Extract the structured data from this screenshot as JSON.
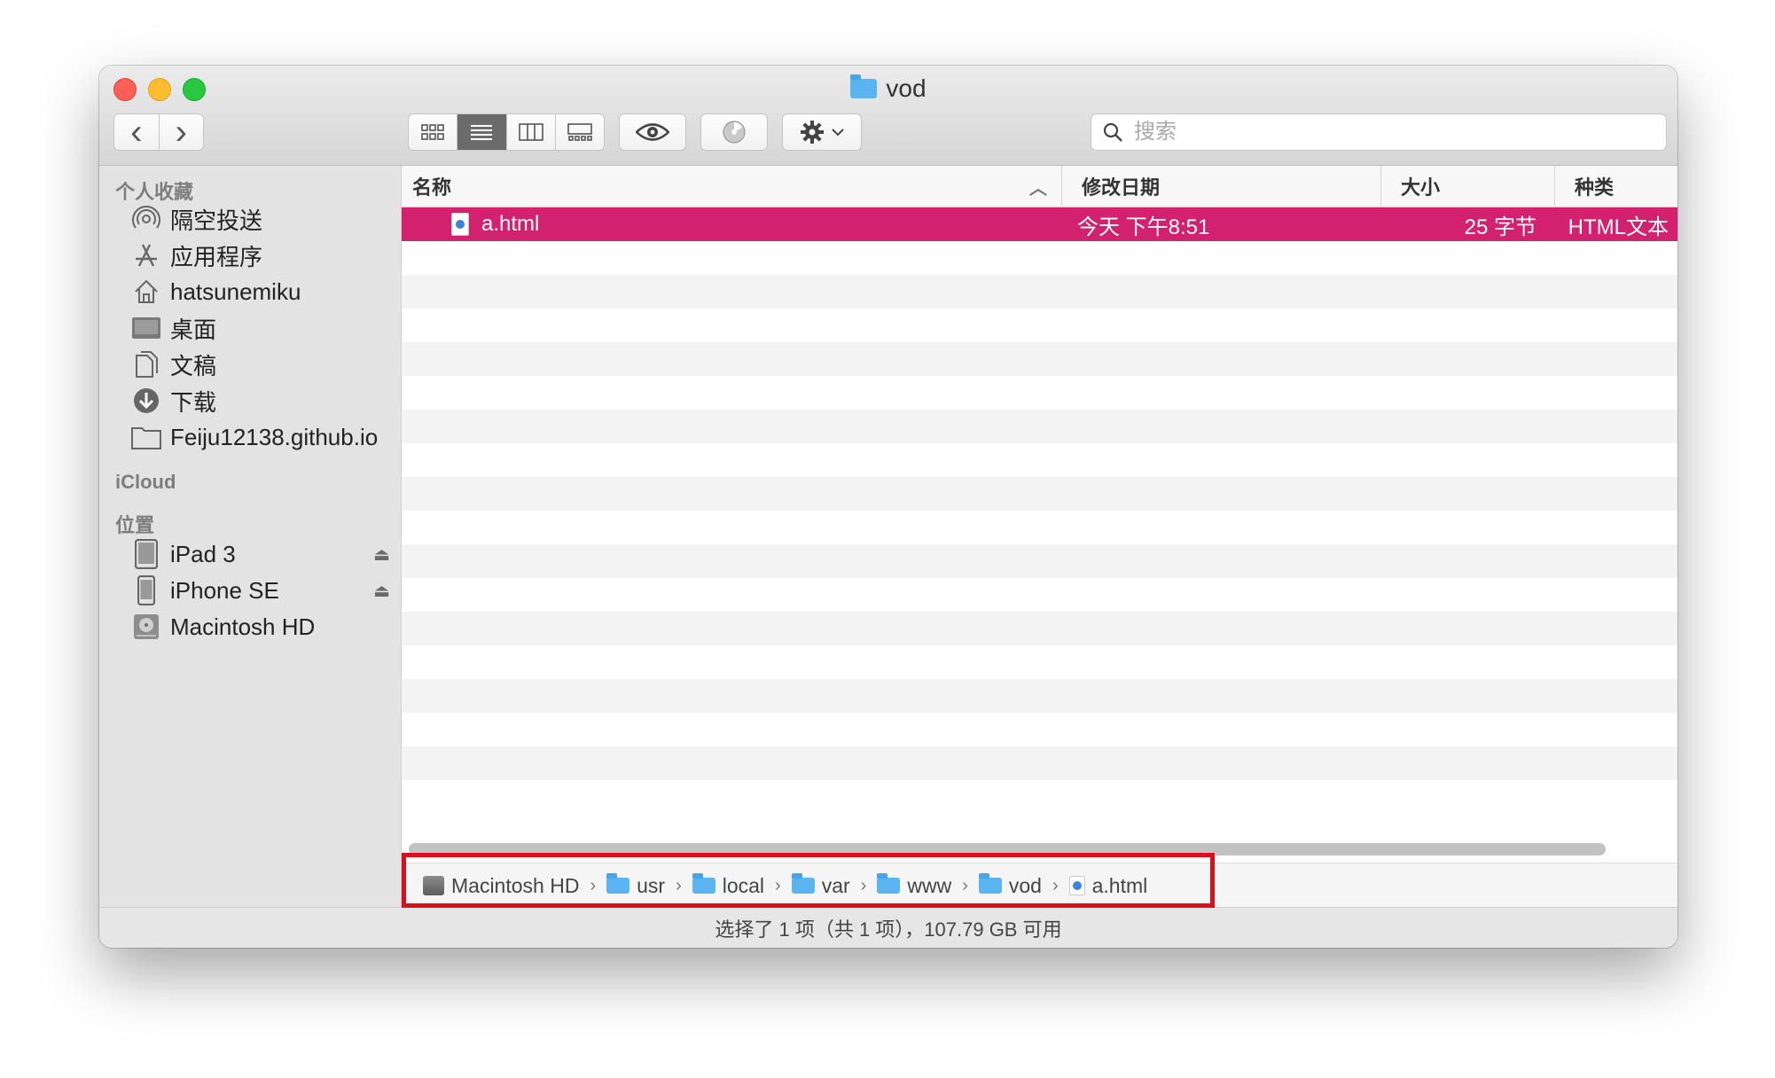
{
  "window": {
    "title": "vod"
  },
  "toolbar": {
    "back_icon": "‹",
    "forward_icon": "›",
    "view_modes": [
      "icon-view",
      "list-view",
      "column-view",
      "gallery-view"
    ],
    "active_view": "list-view",
    "search_placeholder": "搜索"
  },
  "sidebar": {
    "favorites_title": "个人收藏",
    "favorites": [
      {
        "label": "隔空投送",
        "icon": "airdrop-icon"
      },
      {
        "label": "应用程序",
        "icon": "applications-icon"
      },
      {
        "label": "hatsunemiku",
        "icon": "home-icon"
      },
      {
        "label": "桌面",
        "icon": "desktop-icon"
      },
      {
        "label": "文稿",
        "icon": "documents-icon"
      },
      {
        "label": "下载",
        "icon": "downloads-icon"
      },
      {
        "label": "Feiju12138.github.io",
        "icon": "folder-icon"
      }
    ],
    "icloud_title": "iCloud",
    "locations_title": "位置",
    "locations": [
      {
        "label": "iPad 3",
        "icon": "ipad-icon",
        "eject": true
      },
      {
        "label": "iPhone SE",
        "icon": "iphone-icon",
        "eject": true
      },
      {
        "label": "Macintosh HD",
        "icon": "harddisk-icon",
        "eject": false
      }
    ]
  },
  "list": {
    "columns": [
      "名称",
      "修改日期",
      "大小",
      "种类"
    ],
    "sort_indicator": "^",
    "rows": [
      {
        "name": "a.html",
        "modified": "今天 下午8:51",
        "size": "25 字节",
        "kind": "HTML文本",
        "selected": true
      }
    ]
  },
  "path_bar": {
    "segments": [
      {
        "label": "Macintosh HD",
        "icon": "harddisk-icon"
      },
      {
        "label": "usr",
        "icon": "folder-icon"
      },
      {
        "label": "local",
        "icon": "folder-icon"
      },
      {
        "label": "var",
        "icon": "folder-icon"
      },
      {
        "label": "www",
        "icon": "folder-icon"
      },
      {
        "label": "vod",
        "icon": "folder-icon"
      },
      {
        "label": "a.html",
        "icon": "html-file-icon"
      }
    ]
  },
  "status": {
    "text": "选择了 1 项（共 1 项），107.79 GB 可用"
  },
  "colors": {
    "selection": "#d2216f",
    "highlight_box": "#d8101c",
    "folder": "#5ab4f2"
  }
}
